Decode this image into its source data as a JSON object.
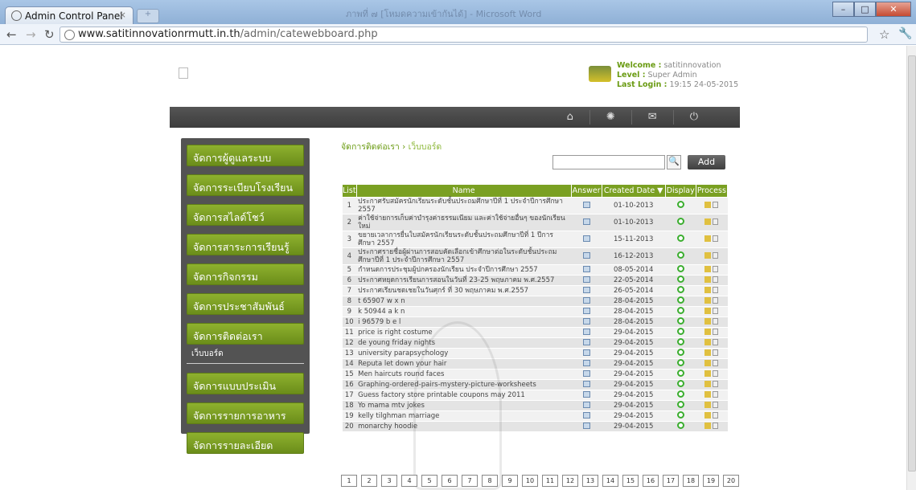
{
  "browser": {
    "tab_title": "Admin Control Panel",
    "url_host": "www.satitinnovationrmutt.in.th",
    "url_path": "/admin/catewebboard.php",
    "window_title": "ภาพที่ ๗ [โหมดความเข้ากันได้] - Microsoft Word"
  },
  "user": {
    "welcome_label": "Welcome :",
    "welcome_value": "satitinnovation",
    "level_label": "Level :",
    "level_value": "Super Admin",
    "login_label": "Last Login :",
    "login_value": "19:15 24-05-2015"
  },
  "menu": [
    "จัดการผู้ดูแลระบบ",
    "จัดการระเบียบโรงเรียน",
    "จัดการสไลด์โชว์",
    "จัดการสาระการเรียนรู้",
    "จัดการกิจกรรม",
    "จัดการประชาสัมพันธ์",
    "จัดการติดต่อเรา",
    "จัดการแบบประเมิน",
    "จัดการรายการอาหาร",
    "จัดการรายละเอียดเว็บไซต์"
  ],
  "submenu": "เว็บบอร์ด",
  "breadcrumb": {
    "main": "จัดการติดต่อเรา",
    "sub": "เว็บบอร์ด"
  },
  "toolbar": {
    "add_label": "Add",
    "search_value": ""
  },
  "table": {
    "headers": [
      "List",
      "Name",
      "Answer",
      "Created Date ▼",
      "Display",
      "Process"
    ],
    "rows": [
      [
        "1",
        "ประกาศรับสมัครนักเรียนระดับชั้นประถมศึกษาปีที่ 1 ประจำปีการศึกษา 2557",
        "01-10-2013"
      ],
      [
        "2",
        "ค่าใช้จ่ายการเก็บค่าบำรุงค่าธรรมเนียม และค่าใช้จ่ายอื่นๆ ของนักเรียนใหม่",
        "01-10-2013"
      ],
      [
        "3",
        "ขยายเวลาการยื่นใบสมัครนักเรียนระดับชั้นประถมศึกษาปีที่ 1 ปีการศึกษา 2557",
        "15-11-2013"
      ],
      [
        "4",
        "ประกาศรายชื่อผู้ผ่านการสอบคัดเลือกเข้าศึกษาต่อในระดับชั้นประถมศึกษาปีที่ 1 ประจำปีการศึกษา 2557",
        "16-12-2013"
      ],
      [
        "5",
        "กำหนดการประชุมผู้ปกครองนักเรียน ประจำปีการศึกษา 2557",
        "08-05-2014"
      ],
      [
        "6",
        "ประกาศหยุดการเรียนการสอนในวันที่ 23-25 พฤษภาคม พ.ศ.2557",
        "22-05-2014"
      ],
      [
        "7",
        "ประกาศเรียนชดเชยในวันศุกร์ ที่ 30 พฤษภาคม พ.ศ.2557",
        "26-05-2014"
      ],
      [
        "8",
        "t 65907 w x n",
        "28-04-2015"
      ],
      [
        "9",
        "k 50944 a k n",
        "28-04-2015"
      ],
      [
        "10",
        "i 96579 b e l",
        "28-04-2015"
      ],
      [
        "11",
        "price is right costume",
        "29-04-2015"
      ],
      [
        "12",
        "de young friday nights",
        "29-04-2015"
      ],
      [
        "13",
        "university parapsychology",
        "29-04-2015"
      ],
      [
        "14",
        "Reputa let down your hair",
        "29-04-2015"
      ],
      [
        "15",
        "Men haircuts round faces",
        "29-04-2015"
      ],
      [
        "16",
        "Graphing-ordered-pairs-mystery-picture-worksheets",
        "29-04-2015"
      ],
      [
        "17",
        "Guess factory store printable coupons may 2011",
        "29-04-2015"
      ],
      [
        "18",
        "Yo mama mtv jokes",
        "29-04-2015"
      ],
      [
        "19",
        "kelly tilghman marriage",
        "29-04-2015"
      ],
      [
        "20",
        "monarchy hoodie",
        "29-04-2015"
      ]
    ]
  },
  "pager": [
    "1",
    "2",
    "3",
    "4",
    "5",
    "6",
    "7",
    "8",
    "9",
    "10",
    "11",
    "12",
    "13",
    "14",
    "15",
    "16",
    "17",
    "18",
    "19",
    "20"
  ]
}
